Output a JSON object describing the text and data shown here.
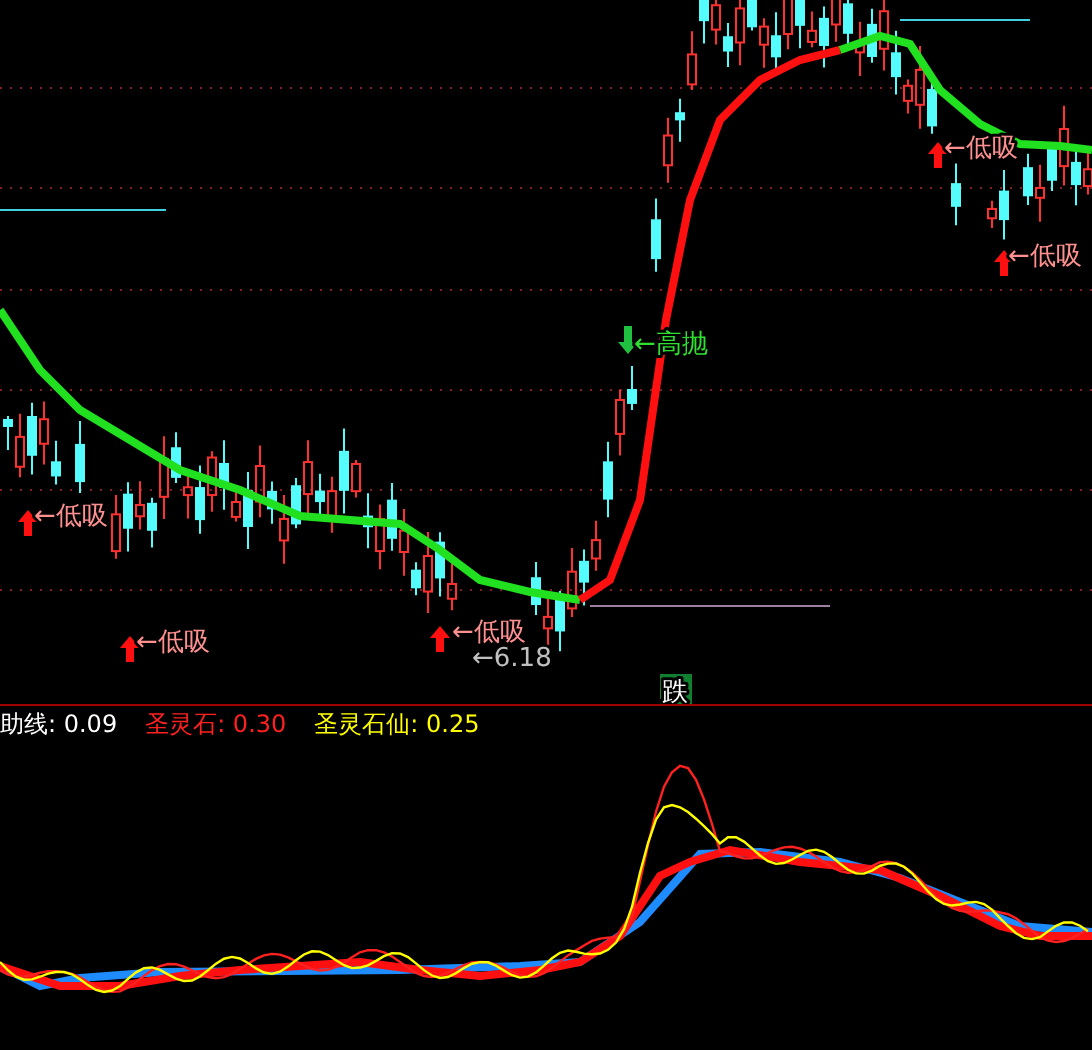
{
  "main_chart": {
    "signals": [
      {
        "kind": "buy",
        "label": "←低吸"
      },
      {
        "kind": "buy",
        "label": "←低吸"
      },
      {
        "kind": "buy",
        "label": "←低吸"
      },
      {
        "kind": "buy",
        "label": "←低吸"
      },
      {
        "kind": "buy",
        "label": "←低吸"
      },
      {
        "kind": "sell",
        "label": "←高抛"
      }
    ],
    "price_label": "←6.18",
    "trend_badge": "跌"
  },
  "indicator": {
    "legend": [
      {
        "label": "助线: 0.09",
        "color": "#ffffff"
      },
      {
        "label": "圣灵石: 0.30",
        "color": "#ff2020"
      },
      {
        "label": "圣灵石仙: 0.25",
        "color": "#ffff00"
      }
    ]
  }
}
